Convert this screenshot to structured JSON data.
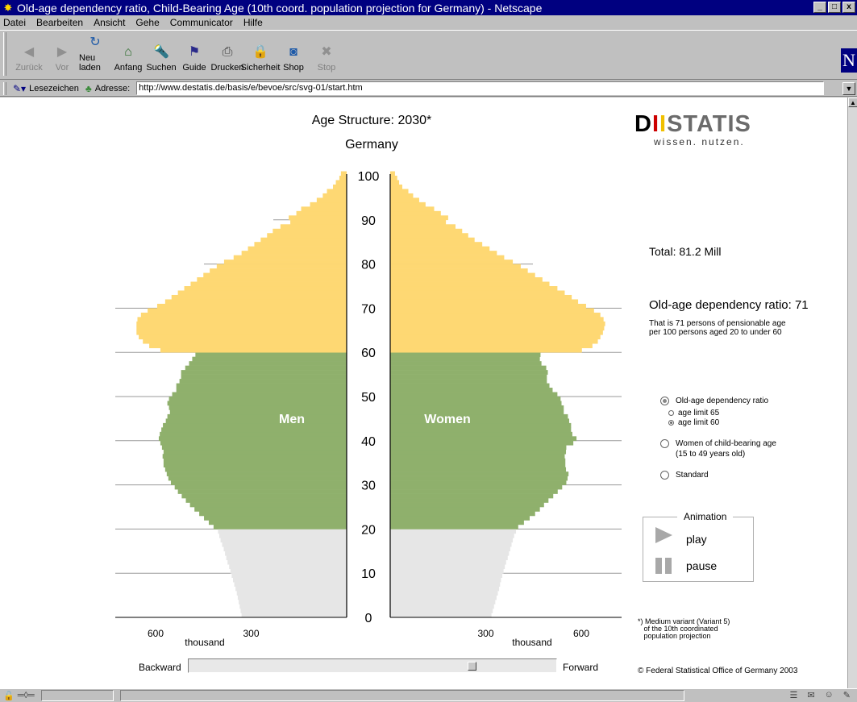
{
  "window": {
    "title": "Old-age dependency ratio, Child-Bearing Age (10th coord. population projection for Germany) - Netscape",
    "controls": [
      "_",
      "□",
      "x"
    ]
  },
  "menu": [
    "Datei",
    "Bearbeiten",
    "Ansicht",
    "Gehe",
    "Communicator",
    "Hilfe"
  ],
  "toolbar": [
    {
      "label": "Zurück",
      "icon": "back-arrow-icon",
      "glyph": "◀",
      "color": "#2e8b57",
      "disabled": true
    },
    {
      "label": "Vor",
      "icon": "forward-arrow-icon",
      "glyph": "▶",
      "color": "#2e8b57",
      "disabled": true
    },
    {
      "label": "Neu laden",
      "icon": "reload-icon",
      "glyph": "↻",
      "color": "#1e5aa8",
      "disabled": false
    },
    {
      "label": "Anfang",
      "icon": "home-icon",
      "glyph": "⌂",
      "color": "#2a6a2a",
      "disabled": false
    },
    {
      "label": "Suchen",
      "icon": "search-icon",
      "glyph": "🔦",
      "color": "#c8a000",
      "disabled": false
    },
    {
      "label": "Guide",
      "icon": "guide-icon",
      "glyph": "⚑",
      "color": "#2a2a8a",
      "disabled": false
    },
    {
      "label": "Drucken",
      "icon": "print-icon",
      "glyph": "⎙",
      "color": "#404040",
      "disabled": false
    },
    {
      "label": "Sicherheit",
      "icon": "security-lock-icon",
      "glyph": "🔒",
      "color": "#a06000",
      "disabled": false
    },
    {
      "label": "Shop",
      "icon": "shop-icon",
      "glyph": "◙",
      "color": "#1e5aa8",
      "disabled": false
    },
    {
      "label": "Stop",
      "icon": "stop-icon",
      "glyph": "✖",
      "color": "#a02020",
      "disabled": true
    }
  ],
  "location": {
    "bookmarks_label": "Lesezeichen",
    "address_label": "Adresse:",
    "url": "http://www.destatis.de/basis/e/bevoe/src/svg-01/start.htm"
  },
  "page": {
    "title": "Age Structure: 2030*",
    "subtitle": "Germany",
    "logo_text": "STATIS",
    "logo_tagline": "wissen. nutzen.",
    "total": "Total: 81.2 Mill",
    "dependency_heading": "Old-age dependency ratio: 71",
    "dependency_line1": "That is  71  persons of pensionable age",
    "dependency_line2": "per 100 persons aged 20 to under 60",
    "options": {
      "old_age": "Old-age dependency ratio",
      "age_limit_65": "age limit 65",
      "age_limit_60": "age limit 60",
      "women_line1": "Women of child-bearing age",
      "women_line2": "(15 to 49 years old)",
      "standard": "Standard",
      "selected": "old_age",
      "age_limit_selected": "60"
    },
    "animation": {
      "label": "Animation",
      "play": "play",
      "pause": "pause"
    },
    "footnote": "*) Medium variant (Variant 5)\n   of the 10th coordinated\n   population projection",
    "copyright": "© Federal Statistical Office of Germany 2003",
    "backward": "Backward",
    "forward": "Forward",
    "slider_fraction": 0.78
  },
  "chart_data": {
    "type": "population-pyramid",
    "title": "Age Structure: 2030*",
    "subtitle": "Germany",
    "y_ticks": [
      0,
      10,
      20,
      30,
      40,
      50,
      60,
      70,
      80,
      90,
      100
    ],
    "x_ticks": [
      600,
      300
    ],
    "x_unit": "thousand",
    "series_labels": {
      "men": "Men",
      "women": "Women"
    },
    "colors": {
      "under_20": "#e6e6e6",
      "age_20_59": "#8fb06c",
      "age_60_plus": "#fed873"
    },
    "age_bands": [
      [
        0,
        19
      ],
      [
        20,
        59
      ],
      [
        60,
        100
      ]
    ],
    "men": [
      330,
      333,
      336,
      339,
      342,
      345,
      349,
      353,
      357,
      361,
      365,
      369,
      374,
      378,
      382,
      386,
      391,
      396,
      400,
      404,
      418,
      433,
      448,
      463,
      478,
      492,
      505,
      518,
      530,
      540,
      552,
      560,
      565,
      570,
      575,
      575,
      578,
      575,
      580,
      585,
      590,
      587,
      582,
      577,
      568,
      563,
      555,
      558,
      563,
      558,
      548,
      535,
      535,
      525,
      520,
      520,
      507,
      495,
      485,
      475,
      585,
      620,
      640,
      653,
      660,
      660,
      660,
      657,
      646,
      625,
      595,
      570,
      550,
      530,
      510,
      490,
      470,
      450,
      430,
      408,
      385,
      355,
      330,
      310,
      290,
      270,
      250,
      232,
      208,
      177,
      182,
      158,
      143,
      115,
      94,
      75,
      62,
      43,
      34,
      23,
      18
    ],
    "women": [
      318,
      322,
      326,
      330,
      334,
      338,
      342,
      345,
      348,
      352,
      356,
      360,
      364,
      369,
      373,
      377,
      381,
      385,
      389,
      395,
      402,
      420,
      438,
      455,
      470,
      483,
      497,
      512,
      526,
      540,
      553,
      557,
      560,
      552,
      550,
      550,
      548,
      552,
      553,
      575,
      585,
      572,
      568,
      568,
      562,
      558,
      545,
      545,
      538,
      535,
      525,
      510,
      500,
      492,
      492,
      495,
      490,
      475,
      470,
      472,
      602,
      635,
      652,
      660,
      668,
      672,
      675,
      670,
      660,
      640,
      615,
      590,
      570,
      548,
      525,
      500,
      478,
      455,
      432,
      410,
      385,
      358,
      335,
      312,
      289,
      265,
      245,
      226,
      205,
      175,
      182,
      159,
      138,
      111,
      91,
      72,
      57,
      38,
      28,
      22,
      15
    ]
  }
}
